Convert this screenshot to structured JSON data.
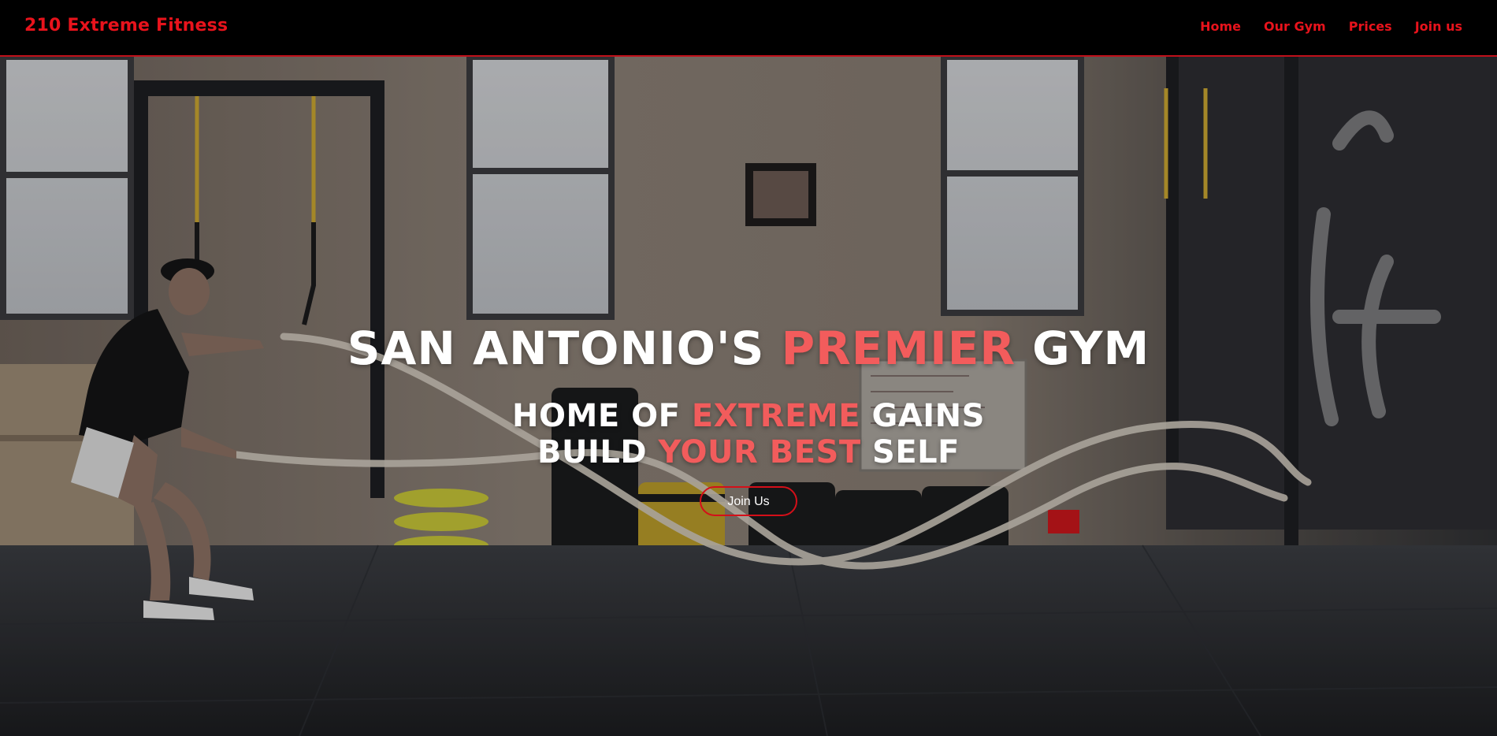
{
  "brand": {
    "name": "210 Extreme Fitness",
    "color": "#e8131c"
  },
  "nav": {
    "items": [
      {
        "label": "Home"
      },
      {
        "label": "Our Gym"
      },
      {
        "label": "Prices"
      },
      {
        "label": "Join us"
      }
    ]
  },
  "hero": {
    "title": {
      "before": "SAN ANTONIO'S ",
      "accent": "PREMIER",
      "after": " GYM"
    },
    "line1": {
      "before": "HOME OF ",
      "accent": "EXTREME",
      "after": " GAINS"
    },
    "line2": {
      "before": "BUILD ",
      "accent": "YOUR BEST",
      "after": " SELF"
    },
    "cta_label": "Join Us",
    "accent_color": "#f25c5c",
    "background_image": "gym-battle-ropes-photo"
  },
  "colors": {
    "navbar_bg": "#000000",
    "nav_text": "#e8131c",
    "button_border": "#d40f19"
  }
}
